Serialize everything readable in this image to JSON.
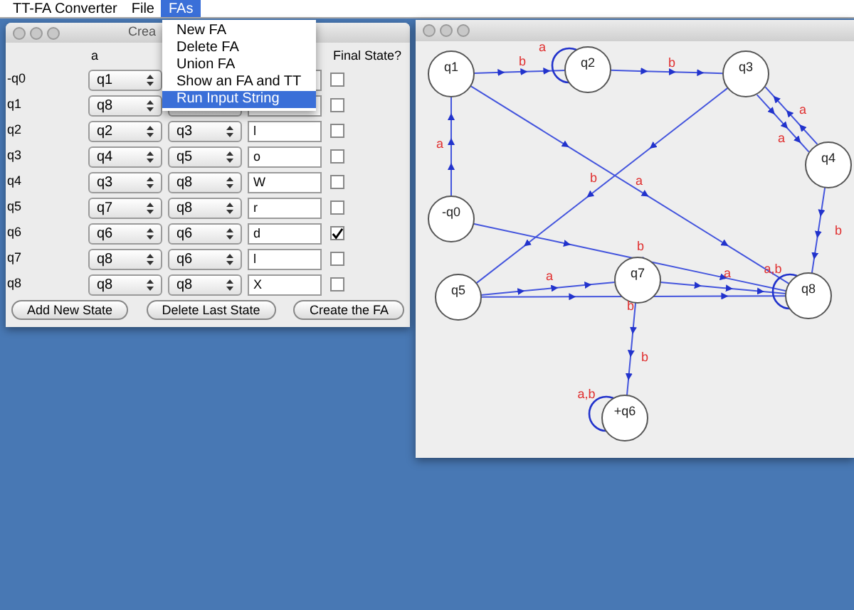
{
  "menubar": [
    {
      "label": "TT-FA Converter",
      "selected": false
    },
    {
      "label": "File",
      "selected": false
    },
    {
      "label": "FAs",
      "selected": true
    }
  ],
  "menu": [
    {
      "label": "New FA",
      "selected": false
    },
    {
      "label": "Delete FA",
      "selected": false
    },
    {
      "label": "Union FA",
      "selected": false
    },
    {
      "label": "Show an FA and TT",
      "selected": false
    },
    {
      "label": "Run Input String",
      "selected": true
    }
  ],
  "create_window": {
    "title": "Crea",
    "columns": {
      "a": "a",
      "final": "Final State?"
    },
    "rows": [
      {
        "state": "-q0",
        "a": "q1",
        "final": false
      },
      {
        "state": "q1",
        "a": "q8",
        "final": false
      },
      {
        "state": "q2",
        "a": "q2",
        "b": "q3",
        "output": "l",
        "final": false
      },
      {
        "state": "q3",
        "a": "q4",
        "b": "q5",
        "output": "o",
        "final": false
      },
      {
        "state": "q4",
        "a": "q3",
        "b": "q8",
        "output": "W",
        "final": false
      },
      {
        "state": "q5",
        "a": "q7",
        "b": "q8",
        "output": "r",
        "final": false
      },
      {
        "state": "q6",
        "a": "q6",
        "b": "q6",
        "output": "d",
        "final": true
      },
      {
        "state": "q7",
        "a": "q8",
        "b": "q6",
        "output": "l",
        "final": false
      },
      {
        "state": "q8",
        "a": "q8",
        "b": "q8",
        "output": "X",
        "final": false
      }
    ],
    "buttons": [
      "Add New State",
      "Delete Last State",
      "Create the FA"
    ]
  },
  "diagram_window": {
    "nodes": [
      {
        "label": "q1"
      },
      {
        "label": "q2"
      },
      {
        "label": "q3"
      },
      {
        "label": "-q0"
      },
      {
        "label": "q4"
      },
      {
        "label": "q7"
      },
      {
        "label": "q5"
      },
      {
        "label": "q8"
      },
      {
        "label": "+q6"
      }
    ],
    "edges": [
      {
        "label": "b"
      },
      {
        "label": "a"
      },
      {
        "label": "b"
      },
      {
        "label": "a"
      },
      {
        "label": "a"
      },
      {
        "label": "a"
      },
      {
        "label": "b"
      },
      {
        "label": "a"
      },
      {
        "label": "b"
      },
      {
        "label": "b"
      },
      {
        "label": "a"
      },
      {
        "label": "a"
      },
      {
        "label": "b"
      },
      {
        "label": "a,b"
      },
      {
        "label": "b"
      },
      {
        "label": "a,b"
      }
    ]
  }
}
